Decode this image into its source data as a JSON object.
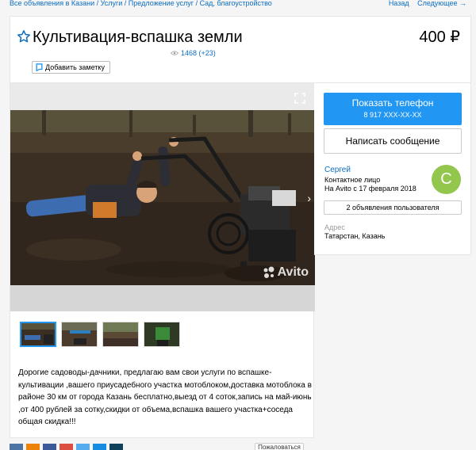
{
  "breadcrumbs": {
    "text": "Все объявления в Казани / Услуги / Предложение услуг / Сад, благоустройство"
  },
  "pager": {
    "back": "Назад",
    "next": "Следующее →"
  },
  "ad": {
    "title": "Культивация-вспашка земли",
    "price": "400 ₽",
    "views": "1468 (+23)",
    "note_button": "Добавить заметку",
    "photo_watermark": "Avito",
    "description": "Дорогие садоводы-дачники, предлагаю вам свои услуги по вспашке-культивации ,вашего приусадебного участка мотоблоком,доставка мотоблока в районе 30 км от города Казань бесплатно,выезд от 4 соток,запись на май-июнь ,от 400 рублей за сотку,скидки от объема,вспашка вашего участка+соседа общая скидка!!!"
  },
  "contact": {
    "phone_button": "Показать телефон",
    "phone_masked": "8 917 XXX-XX-XX",
    "message_button": "Написать сообщение"
  },
  "seller": {
    "name": "Сергей",
    "role": "Контактное лицо",
    "since": "На Avito с 17 февраля 2018",
    "avatar_letter": "С",
    "ads_button": "2 объявления пользователя"
  },
  "address": {
    "label": "Адрес",
    "value": "Татарстан, Казань"
  },
  "footer": {
    "complain": "Пожаловаться"
  },
  "colors": {
    "accent": "#2196f3",
    "link": "#0a6dc2",
    "avatar": "#92c64d"
  }
}
